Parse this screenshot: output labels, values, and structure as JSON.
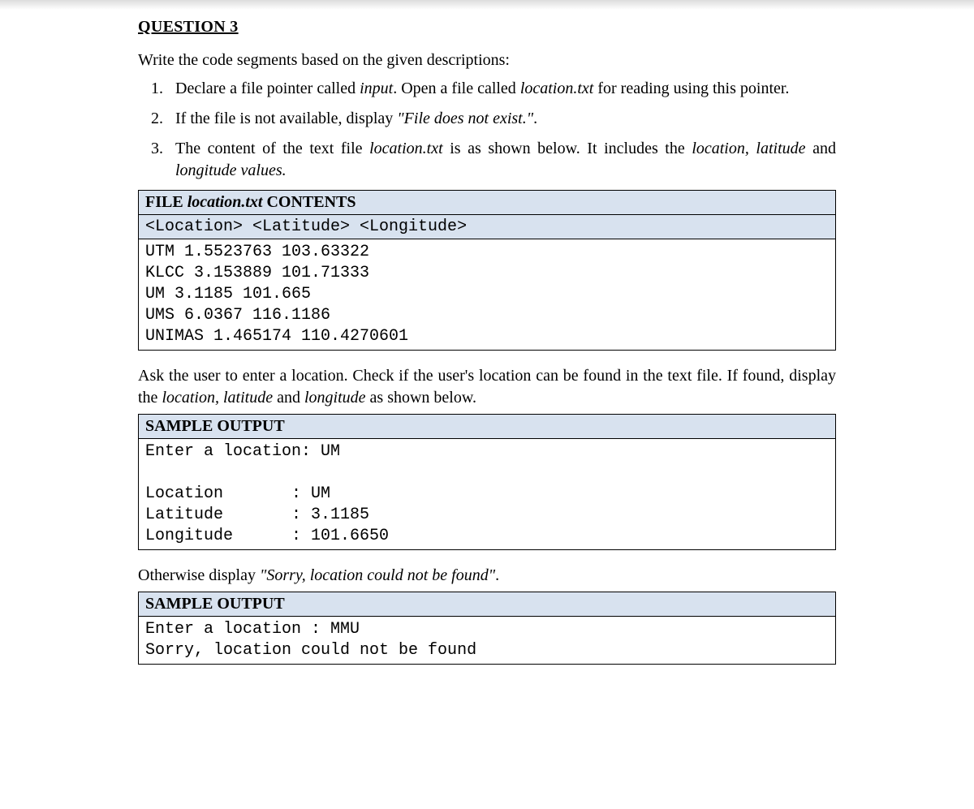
{
  "title": "QUESTION 3",
  "intro": "Write the code segments based on the given descriptions:",
  "items": {
    "i1a": "Declare a file pointer called ",
    "i1b": "input",
    "i1c": ". Open a file called ",
    "i1d": "location.txt",
    "i1e": " for reading using this pointer.",
    "i2a": "If the file is not available, display ",
    "i2b": "\"File does not exist.\"",
    "i2c": ".",
    "i3a": "The content of the text file ",
    "i3b": "location.txt",
    "i3c": " is as shown below. It includes the ",
    "i3d": "location, latitude",
    "i3e": " and ",
    "i3f": "longitude values."
  },
  "file_block": {
    "header_a": "FILE ",
    "header_b": "location.txt",
    "header_c": " CONTENTS",
    "sub": "<Location> <Latitude> <Longitude>",
    "lines": [
      "UTM 1.5523763 103.63322",
      "KLCC 3.153889 101.71333",
      "UM 3.1185 101.665",
      "UMS 6.0367 116.1186",
      "UNIMAS 1.465174 110.4270601"
    ]
  },
  "mid_para": {
    "a": "Ask the user to enter a location. Check if the user's location can be found in the text file. If found, display the ",
    "b": "location, latitude",
    "c": " and ",
    "d": "longitude",
    "e": " as shown below."
  },
  "sample1": {
    "header": "SAMPLE OUTPUT",
    "lines": [
      "Enter a location: UM",
      "",
      "Location       : UM",
      "Latitude       : 3.1185",
      "Longitude      : 101.6650"
    ]
  },
  "otherwise": {
    "a": "Otherwise display ",
    "b": "\"Sorry, location could not be found\"",
    "c": "."
  },
  "sample2": {
    "header": "SAMPLE OUTPUT",
    "lines": [
      "Enter a location : MMU",
      "Sorry, location could not be found"
    ]
  }
}
